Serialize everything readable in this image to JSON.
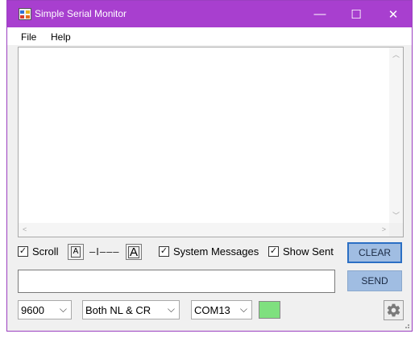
{
  "window": {
    "title": "Simple Serial Monitor",
    "icon": "app-icon",
    "controls": {
      "minimize": "—",
      "maximize": "☐",
      "close": "✕"
    },
    "accent_color": "#a83fcf"
  },
  "menu": {
    "items": [
      {
        "label": "File"
      },
      {
        "label": "Help"
      }
    ]
  },
  "output": {
    "text": ""
  },
  "options": {
    "scroll": {
      "label": "Scroll",
      "checked": true
    },
    "font_small": {
      "glyph": "A"
    },
    "font_size_slider": {
      "ticks": "–I–––"
    },
    "font_large": {
      "glyph": "A"
    },
    "system_messages": {
      "label": "System Messages",
      "checked": true
    },
    "show_sent": {
      "label": "Show Sent",
      "checked": true
    }
  },
  "buttons": {
    "clear": "CLEAR",
    "send": "SEND"
  },
  "send_input": {
    "value": "",
    "placeholder": ""
  },
  "settings": {
    "baud_rate": "9600",
    "line_ending": "Both NL & CR",
    "port": "COM13",
    "connection_status_color": "#7fe07f"
  },
  "icons": {
    "settings": "gear-icon",
    "check": "✓"
  }
}
